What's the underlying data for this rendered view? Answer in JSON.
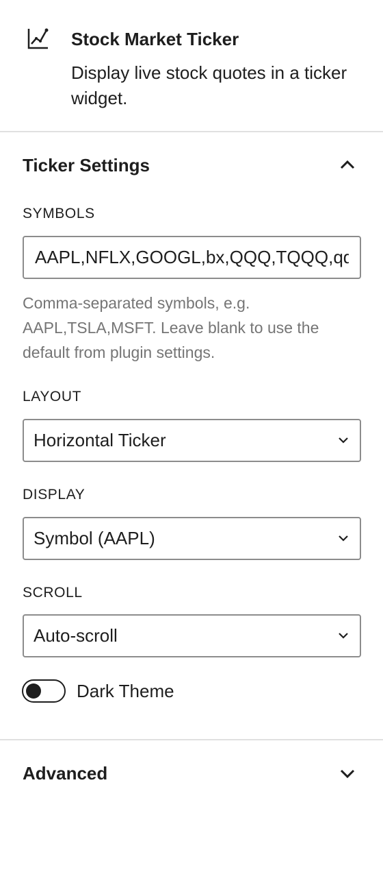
{
  "block": {
    "icon": "line-chart-icon",
    "title": "Stock Market Ticker",
    "description": "Display live stock quotes in a ticker widget."
  },
  "ticker_settings": {
    "title": "Ticker Settings",
    "expanded": true,
    "toggle_icon": "chevron-up-icon",
    "symbols": {
      "label": "Symbols",
      "value": "AAPL,NFLX,GOOGL,bx,QQQ,TQQQ,qqq",
      "help": "Comma-separated symbols, e.g. AAPL,TSLA,MSFT. Leave blank to use the default from plugin settings."
    },
    "layout": {
      "label": "Layout",
      "value": "Horizontal Ticker",
      "icon": "chevron-down-icon"
    },
    "display": {
      "label": "Display",
      "value": "Symbol (AAPL)",
      "icon": "chevron-down-icon"
    },
    "scroll": {
      "label": "Scroll",
      "value": "Auto-scroll",
      "icon": "chevron-down-icon"
    },
    "dark_theme": {
      "label": "Dark Theme",
      "checked": false
    }
  },
  "advanced": {
    "title": "Advanced",
    "expanded": false,
    "toggle_icon": "chevron-down-icon"
  },
  "colors": {
    "text": "#1e1e1e",
    "help_text": "#757575",
    "border": "#8c8c8c",
    "divider": "#e0e0e0"
  }
}
